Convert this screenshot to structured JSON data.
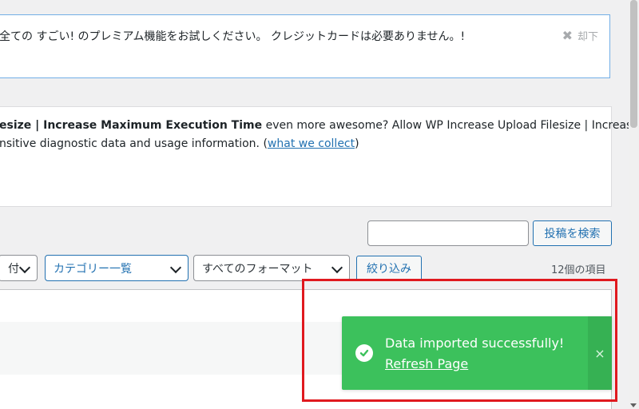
{
  "premium_notice": {
    "text": "全ての すごい! のプレミアム機能をお試しください。 クレジットカードは必要ありません。!",
    "dismiss_label": "却下"
  },
  "optin": {
    "line1_bold": "esize | Increase Maximum Execution Time",
    "line1_rest": " even more awesome? Allow WP Increase Upload Filesize | Increase",
    "line2_pre": "nsitive diagnostic data and usage information. (",
    "line2_link": "what we collect",
    "line2_post": ")"
  },
  "search": {
    "button_label": "投稿を検索",
    "value": ""
  },
  "filters": {
    "date_label": "日付",
    "category_label": "カテゴリー一覧",
    "format_label": "すべてのフォーマット",
    "filter_button": "絞り込み",
    "item_count": "12個の項目"
  },
  "toast": {
    "message": "Data imported successfully!",
    "link_label": "Refresh Page",
    "close_glyph": "×"
  },
  "colors": {
    "toast_bg": "#3cc15c",
    "highlight": "#e0191f",
    "link": "#2271b1"
  }
}
